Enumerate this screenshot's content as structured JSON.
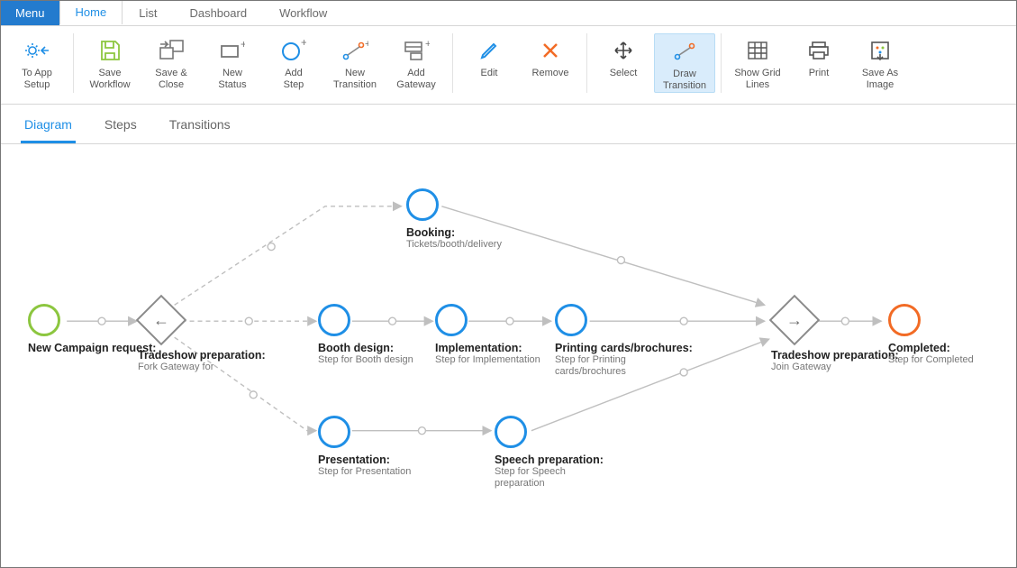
{
  "topnav": {
    "menu": "Menu",
    "tabs": [
      "Home",
      "List",
      "Dashboard",
      "Workflow"
    ],
    "active": "Home"
  },
  "ribbon": {
    "items": [
      {
        "id": "to-app-setup",
        "label": "To App\nSetup"
      },
      {
        "id": "save-workflow",
        "label": "Save\nWorkflow"
      },
      {
        "id": "save-close",
        "label": "Save &\nClose"
      },
      {
        "id": "new-status",
        "label": "New\nStatus"
      },
      {
        "id": "add-step",
        "label": "Add\nStep"
      },
      {
        "id": "new-transition",
        "label": "New\nTransition"
      },
      {
        "id": "add-gateway",
        "label": "Add\nGateway"
      },
      {
        "id": "edit",
        "label": "Edit"
      },
      {
        "id": "remove",
        "label": "Remove"
      },
      {
        "id": "select",
        "label": "Select"
      },
      {
        "id": "draw-transition",
        "label": "Draw\nTransition",
        "active": true
      },
      {
        "id": "show-grid",
        "label": "Show Grid\nLines"
      },
      {
        "id": "print",
        "label": "Print"
      },
      {
        "id": "save-image",
        "label": "Save As\nImage"
      }
    ]
  },
  "subtabs": {
    "items": [
      "Diagram",
      "Steps",
      "Transitions"
    ],
    "active": "Diagram"
  },
  "nodes": {
    "start": {
      "title": "New Campaign request:",
      "desc": ""
    },
    "fork": {
      "title": "Tradeshow preparation:",
      "desc": "Fork Gateway for"
    },
    "booking": {
      "title": "Booking:",
      "desc": "Tickets/booth/delivery"
    },
    "booth": {
      "title": "Booth design:",
      "desc": "Step for Booth design"
    },
    "impl": {
      "title": "Implementation:",
      "desc": "Step for Implementation"
    },
    "print": {
      "title": "Printing cards/brochures:",
      "desc": "Step for Printing cards/brochures"
    },
    "presentation": {
      "title": "Presentation:",
      "desc": "Step for Presentation"
    },
    "speech": {
      "title": "Speech preparation:",
      "desc": "Step for Speech preparation"
    },
    "join": {
      "title": "Tradeshow preparation:",
      "desc": "Join Gateway"
    },
    "completed": {
      "title": "Completed:",
      "desc": "Step for Completed"
    }
  }
}
